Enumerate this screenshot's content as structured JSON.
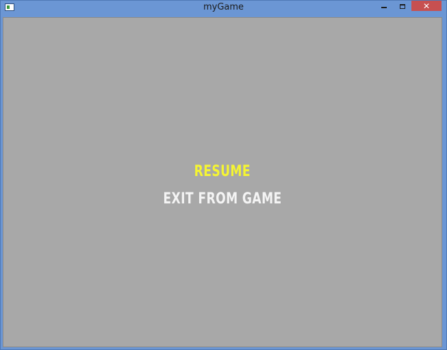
{
  "window": {
    "title": "myGame",
    "close_glyph": "✕",
    "icons": {
      "app": "app-window-icon",
      "minimize": "minimize-icon",
      "maximize": "maximize-icon",
      "close": "close-icon"
    }
  },
  "pause_menu": {
    "items": [
      {
        "label": "RESUME",
        "selected": true
      },
      {
        "label": "EXIT FROM GAME",
        "selected": false
      }
    ]
  },
  "colors": {
    "selected_item": "#f5f532",
    "normal_item": "#f4f4f4",
    "background": "#a8a8a8",
    "frame": "#6b96d4",
    "close_button": "#c75050"
  }
}
